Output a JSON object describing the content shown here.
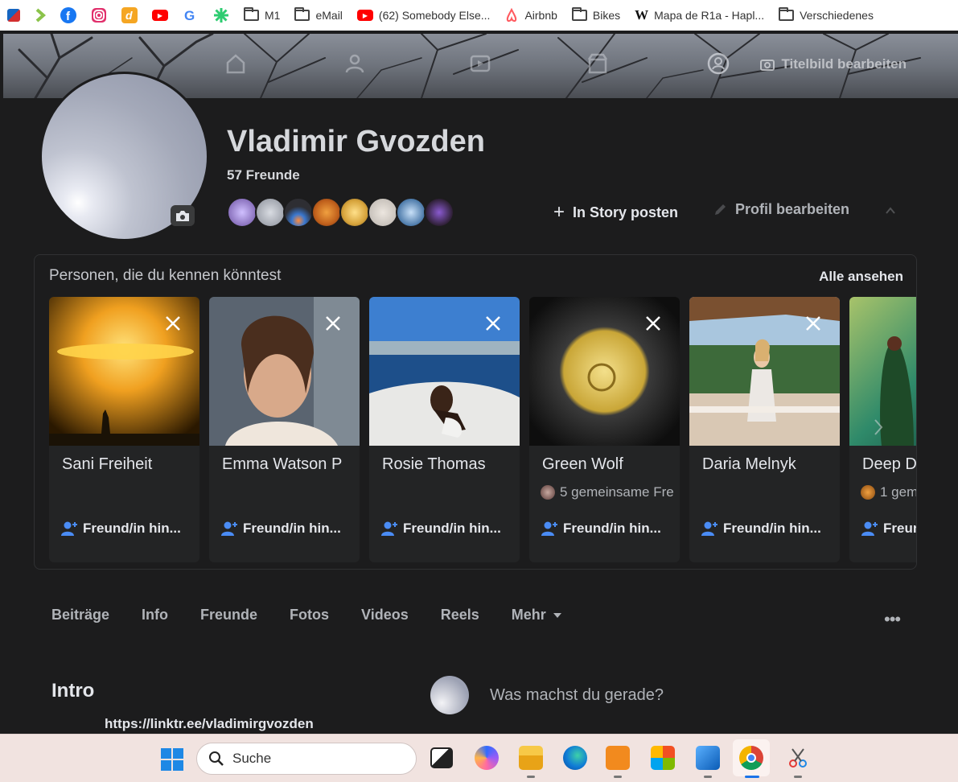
{
  "bookmarks": [
    {
      "label": "",
      "icon": "multicolor-app-icon",
      "color": "#d32f2f"
    },
    {
      "label": "",
      "icon": "chevron-app-icon",
      "color": "#8bc34a"
    },
    {
      "label": "",
      "icon": "facebook-icon",
      "color": "#1877f2"
    },
    {
      "label": "",
      "icon": "instagram-icon",
      "color": "#e1306c"
    },
    {
      "label": "",
      "icon": "d-app-icon",
      "color": "#f5a623"
    },
    {
      "label": "",
      "icon": "youtube-icon",
      "color": "#ff0000"
    },
    {
      "label": "",
      "icon": "google-icon",
      "color": "#4285f4"
    },
    {
      "label": "",
      "icon": "green-star-icon",
      "color": "#2ecc71"
    },
    {
      "label": "M1",
      "icon": "folder-icon"
    },
    {
      "label": "eMail",
      "icon": "folder-icon"
    },
    {
      "label": "(62) Somebody Else...",
      "icon": "youtube-icon"
    },
    {
      "label": "Airbnb",
      "icon": "airbnb-icon"
    },
    {
      "label": "Bikes",
      "icon": "folder-icon"
    },
    {
      "label": "Mapa de R1a - Hapl...",
      "icon": "wikipedia-icon"
    },
    {
      "label": "Verschiedenes",
      "icon": "folder-icon"
    }
  ],
  "cover": {
    "edit_label": "Titelbild bearbeiten"
  },
  "profile": {
    "name": "Vladimir Gvozden",
    "friends_count": "57 Freunde",
    "story_button": "In Story posten",
    "edit_button": "Profil bearbeiten",
    "friend_avatar_colors": [
      "#6b4fa0",
      "#8a8f99",
      "#2e2e33",
      "#c0601c",
      "#d7a43c",
      "#b9b3ad",
      "#4a78a8",
      "#2d1f33"
    ]
  },
  "suggestions": {
    "title": "Personen, die du kennen könntest",
    "see_all": "Alle ansehen",
    "add_label": "Freund/in hin...",
    "cards": [
      {
        "name": "Sani Freiheit",
        "mutual": "",
        "img": "sunset"
      },
      {
        "name": "Emma Watson P",
        "mutual": "",
        "img": "portrait"
      },
      {
        "name": "Rosie Thomas",
        "mutual": "",
        "img": "sea"
      },
      {
        "name": "Green Wolf",
        "mutual": "5 gemeinsame Fre",
        "img": "coin"
      },
      {
        "name": "Daria Melnyk",
        "mutual": "",
        "img": "balcony"
      },
      {
        "name": "Deep D",
        "mutual": "1 gem",
        "img": "forest"
      }
    ]
  },
  "tabs": [
    "Beiträge",
    "Info",
    "Freunde",
    "Fotos",
    "Videos",
    "Reels",
    "Mehr"
  ],
  "intro": {
    "title": "Intro",
    "link": "https://linktr.ee/vladimirgvozden"
  },
  "composer": {
    "placeholder": "Was machst du gerade?"
  },
  "taskbar": {
    "search_label": "Suche"
  }
}
